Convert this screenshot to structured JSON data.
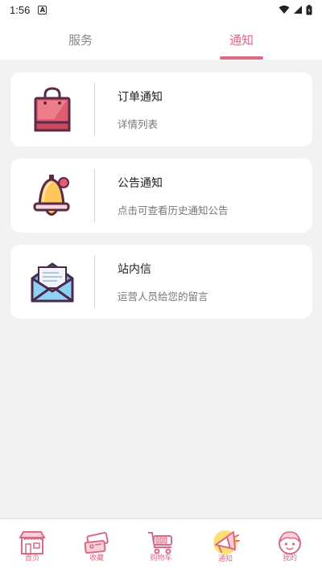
{
  "status": {
    "time": "1:56",
    "badge": "A"
  },
  "tabs": [
    {
      "label": "服务",
      "active": false
    },
    {
      "label": "通知",
      "active": true
    }
  ],
  "notifications": [
    {
      "title": "订单通知",
      "subtitle": "详情列表",
      "icon": "shopping-bag-icon"
    },
    {
      "title": "公告通知",
      "subtitle": "点击可查看历史通知公告",
      "icon": "bell-icon"
    },
    {
      "title": "站内信",
      "subtitle": "运营人员给您的留言",
      "icon": "envelope-icon"
    }
  ],
  "bottom_nav": [
    {
      "label": "首页",
      "icon": "storefront-icon"
    },
    {
      "label": "收藏",
      "icon": "tickets-icon"
    },
    {
      "label": "购物车",
      "icon": "cart-icon"
    },
    {
      "label": "通知",
      "icon": "megaphone-icon"
    },
    {
      "label": "我的",
      "icon": "profile-face-icon"
    }
  ],
  "colors": {
    "accent": "#d96b87",
    "background": "#f2f2f2",
    "card": "#ffffff"
  }
}
